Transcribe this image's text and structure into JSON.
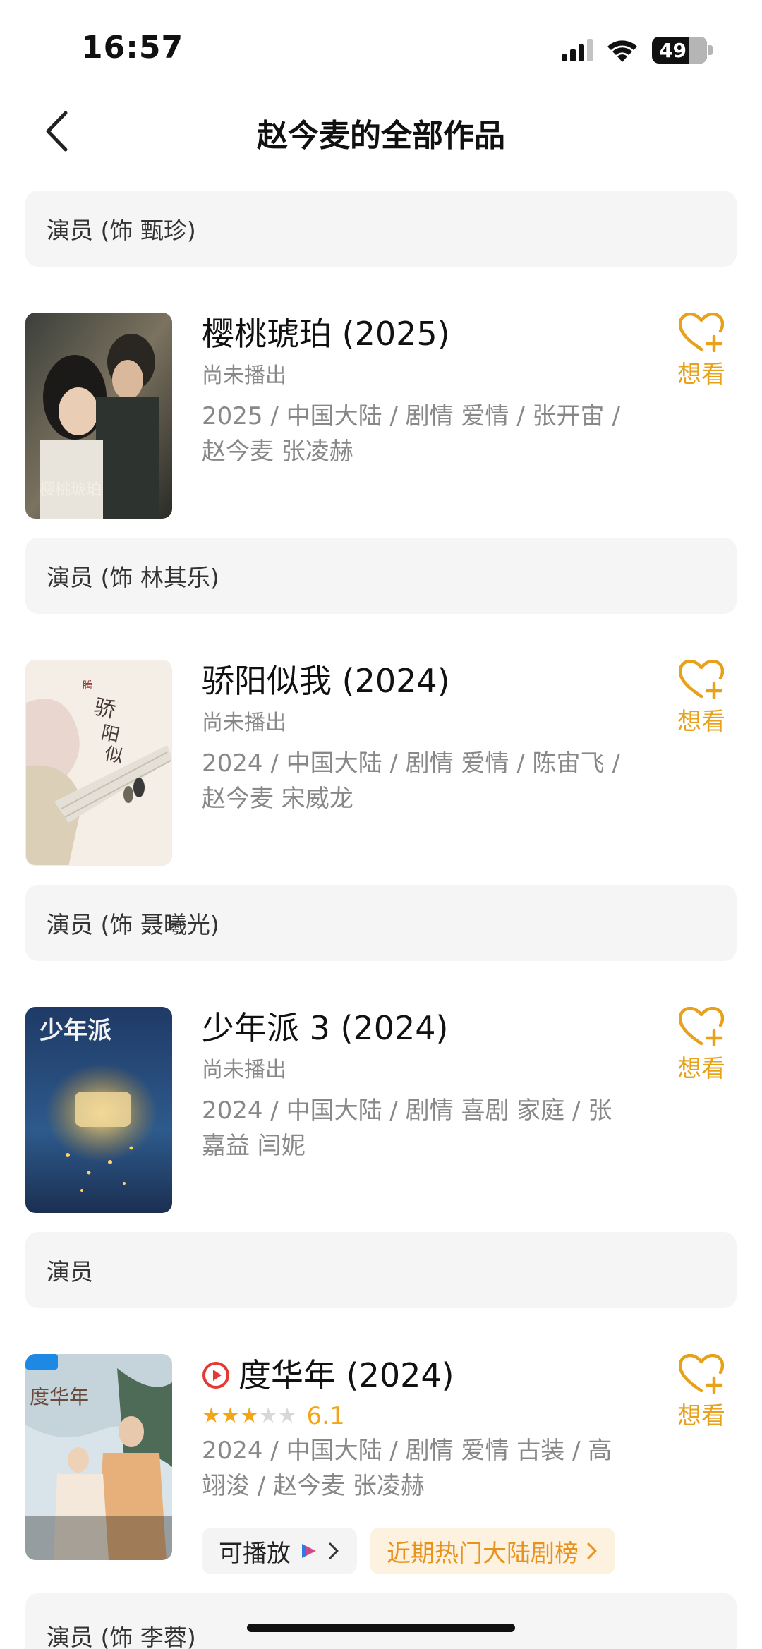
{
  "status": {
    "time": "16:57",
    "battery": "49"
  },
  "nav": {
    "title": "赵今麦的全部作品"
  },
  "sections": [
    {
      "role": "演员 (饰 甄珍)",
      "title": "樱桃琥珀 (2025)",
      "status": "尚未播出",
      "meta": "2025 / 中国大陆 / 剧情 爱情 / 张开宙 / 赵今麦 张凌赫",
      "want": "想看"
    },
    {
      "role": "演员 (饰 林其乐)",
      "title": "骄阳似我 (2024)",
      "status": "尚未播出",
      "meta": "2024 / 中国大陆 / 剧情 爱情 / 陈宙飞 / 赵今麦 宋威龙",
      "want": "想看"
    },
    {
      "role": "演员 (饰 聂曦光)",
      "title": "少年派 3 (2024)",
      "status": "尚未播出",
      "meta": "2024 / 中国大陆 / 剧情 喜剧 家庭 / 张嘉益 闫妮",
      "want": "想看"
    },
    {
      "role": "演员",
      "title": "度华年 (2024)",
      "rating": {
        "stars": 3,
        "max": 5,
        "value": "6.1"
      },
      "meta": "2024 / 中国大陆 / 剧情 爱情 古装 / 高翊浚 / 赵今麦 张凌赫",
      "want": "想看",
      "play_label": "可播放",
      "hot_label": "近期热门大陆剧榜"
    }
  ],
  "last_role": "演员 (饰 李蓉)",
  "colors": {
    "accent": "#e8a11b",
    "role_bg": "#f5f5f5",
    "play_icon": "#e53935"
  },
  "icons": [
    "back-icon",
    "signal-icon",
    "wifi-icon",
    "battery-icon",
    "heart-plus-icon",
    "play-circle-icon",
    "star-icon",
    "youku-icon",
    "chevron-right-icon"
  ]
}
